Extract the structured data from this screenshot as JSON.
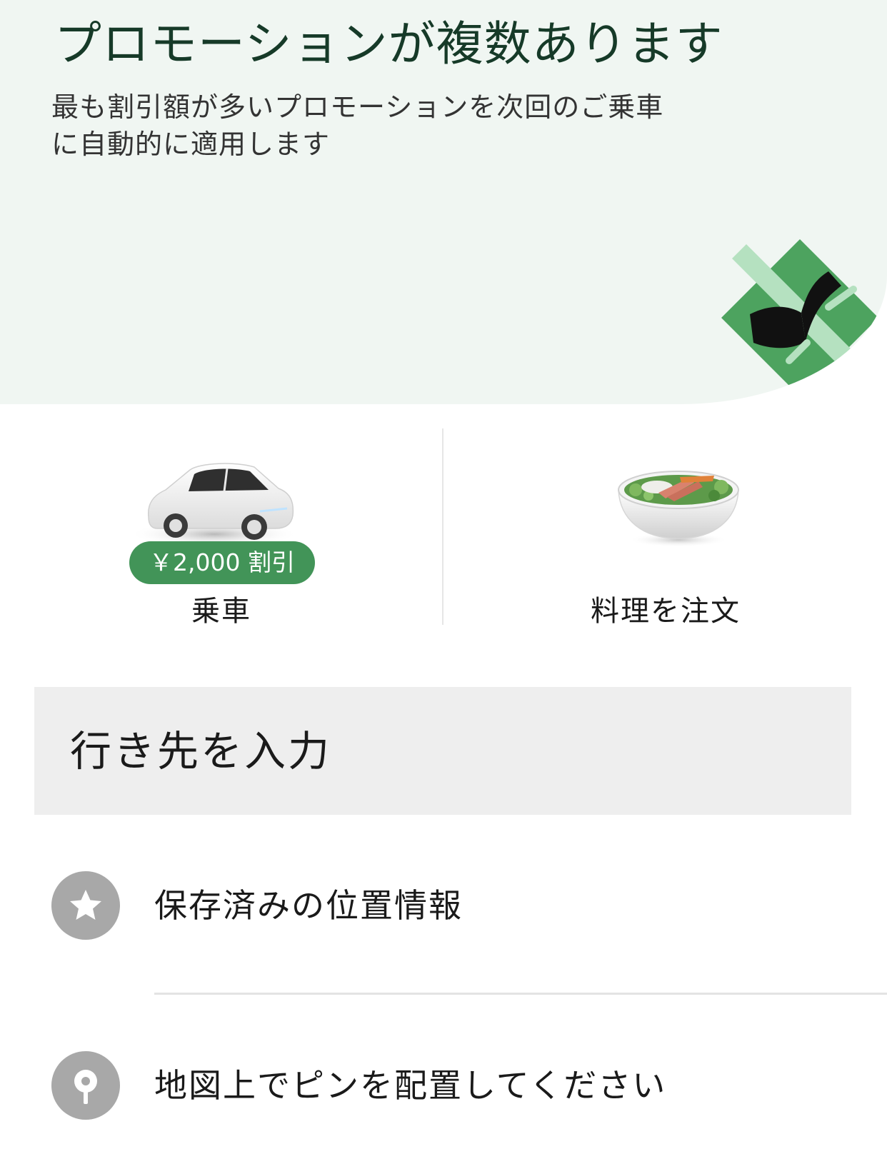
{
  "promo": {
    "title": "プロモーションが複数あります",
    "subtitle": "最も割引額が多いプロモーションを次回のご乗車に自動的に適用します",
    "tag_icon": "promo-tag-icon",
    "colors": {
      "banner_background": "#f0f6f2",
      "title": "#163a28",
      "accent": "#429458"
    }
  },
  "services": {
    "ride": {
      "label": "乗車",
      "badge": "￥2,000 割引",
      "icon": "car-icon"
    },
    "food": {
      "label": "料理を注文",
      "icon": "food-bowl-icon"
    }
  },
  "search": {
    "placeholder": "行き先を入力"
  },
  "options": {
    "saved_places": {
      "label": "保存済みの位置情報",
      "icon": "star-icon"
    },
    "set_pin": {
      "label": "地図上でピンを配置してください",
      "icon": "location-pin-icon"
    }
  }
}
